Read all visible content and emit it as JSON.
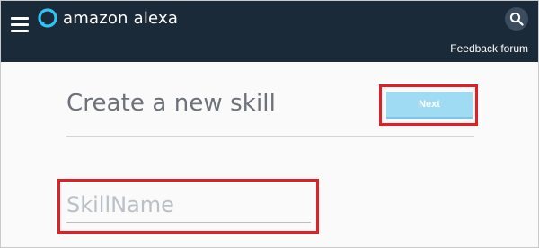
{
  "app": {
    "name": "amazon alexa"
  },
  "header": {
    "menu_icon": "hamburger-menu-icon",
    "logo_icon": "alexa-ring-icon",
    "search_icon": "search-icon",
    "feedback_label": "Feedback forum",
    "background_color": "#1b2a38",
    "logo_color": "#31c4f3"
  },
  "main": {
    "title": "Create a new skill",
    "next_label": "Next",
    "next_button_color": "#9fdcf4",
    "skill_name": {
      "value": "",
      "placeholder": "SkillName"
    }
  },
  "highlights": {
    "color": "#e31e24",
    "targets": [
      "next-button",
      "skill-name-input"
    ]
  }
}
